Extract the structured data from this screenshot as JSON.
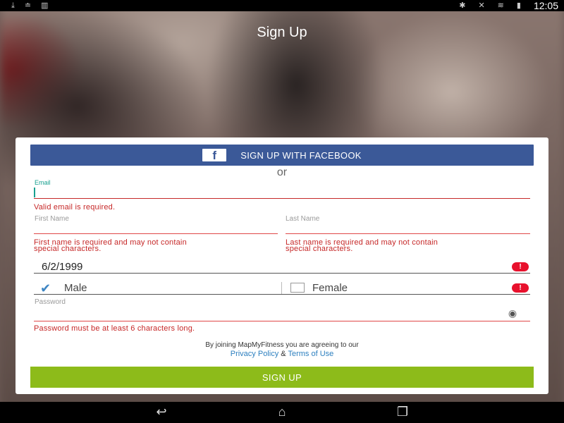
{
  "status_bar": {
    "left_icons": [
      "download-icon",
      "sms-icon",
      "barcode-icon"
    ],
    "right_icons": [
      "bluetooth-icon",
      "mute-icon",
      "wifi-icon",
      "battery-icon"
    ],
    "time": "12:05"
  },
  "header": {
    "title": "Sign Up"
  },
  "form": {
    "facebook_button": "SIGN UP WITH FACEBOOK",
    "facebook_logo": "f",
    "or_text": "or",
    "email": {
      "label": "Email",
      "value": "",
      "error": "Valid email is required."
    },
    "first_name": {
      "label": "First Name",
      "value": "",
      "error_line1": "First name is required and may not contain",
      "error_line2": "special characters."
    },
    "last_name": {
      "label": "Last Name",
      "value": "",
      "error_line1": "Last name is required and may not contain",
      "error_line2": "special characters."
    },
    "birthdate": {
      "value": "6/2/1999"
    },
    "gender": {
      "male_label": "Male",
      "female_label": "Female",
      "male_checked": true,
      "female_checked": false
    },
    "password": {
      "label": "Password",
      "value": "",
      "error": "Password must be at least 6 characters long."
    },
    "terms_line1": "By joining MapMyFitness you are agreeing to our",
    "privacy_link": "Privacy Policy",
    "amp": "&",
    "terms_link": "Terms of Use",
    "signup_button": "SIGN UP"
  },
  "nav_bar": {
    "icons": [
      "back-icon",
      "home-icon",
      "recents-icon"
    ]
  },
  "colors": {
    "facebook": "#3b5998",
    "signup": "#8dbb1a",
    "error": "#c62828",
    "accent": "#17a08f",
    "link": "#2c7fbf"
  }
}
